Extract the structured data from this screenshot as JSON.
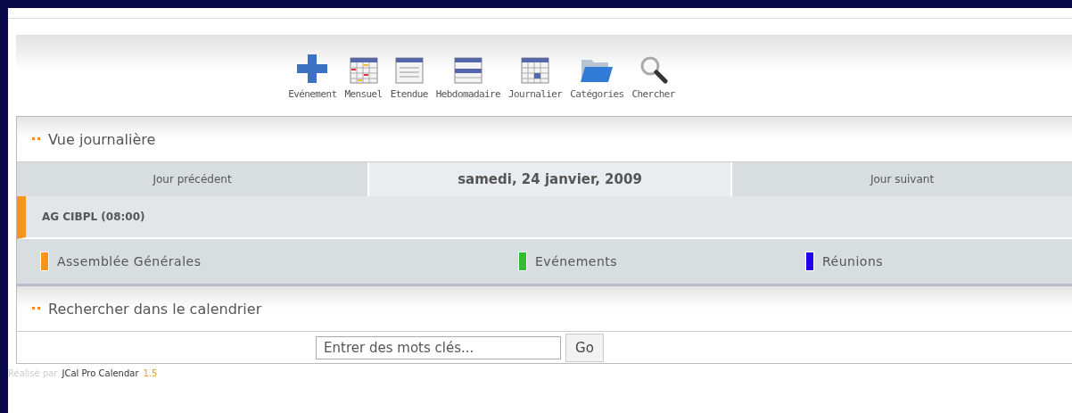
{
  "toolbar": [
    {
      "kind": "add",
      "label": "Evénement"
    },
    {
      "kind": "month",
      "label": "Mensuel"
    },
    {
      "kind": "range",
      "label": "Etendue"
    },
    {
      "kind": "week",
      "label": "Hebdomadaire"
    },
    {
      "kind": "day",
      "label": "Journalier"
    },
    {
      "kind": "folder",
      "label": "Catégories"
    },
    {
      "kind": "search",
      "label": "Chercher"
    }
  ],
  "day_view": {
    "title": "Vue journalière",
    "previous": "Jour précédent",
    "date": "samedi, 24 janvier, 2009",
    "next": "Jour suivant",
    "events": [
      {
        "label": "AG CIBPL (08:00)",
        "color": "#f7941d"
      }
    ],
    "categories": [
      {
        "label": "Assemblée Générales",
        "color": "#f7941d"
      },
      {
        "label": "Evénements",
        "color": "#33bb33"
      },
      {
        "label": "Réunions",
        "color": "#2200ee"
      }
    ]
  },
  "search": {
    "title": "Rechercher dans le calendrier",
    "placeholder": "Entrer des mots clés...",
    "button": "Go"
  },
  "footer": {
    "prefix": "Réalisé par",
    "product": "JCal Pro Calendar",
    "version": "1.5"
  }
}
